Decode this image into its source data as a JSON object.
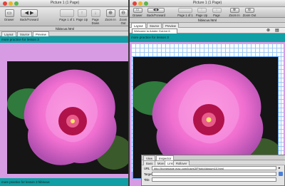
{
  "left_window": {
    "title": "Picture 1 (1 Page)",
    "toolbar": {
      "drawer": "Drawer",
      "back_forward": "Back/Forward",
      "page_of": "Page 1 of 1",
      "page_up": "Page Up",
      "page_down": "Page Down",
      "zoom_in": "Zoom In",
      "zoom_out": "Zoom Out"
    },
    "doc_title": "hibiscus.html",
    "tabs": [
      "Layout",
      "Source",
      "Preview"
    ],
    "heading": "more practice for lesson 3",
    "footer_text": "more practice for lesson 3 hibiscus"
  },
  "right_window": {
    "title": "Picture 1 (1 Page)",
    "toolbar": {
      "drawer": "Drawer",
      "back_forward": "Back/Forward",
      "page_of": "Page 1 of 1",
      "page_up": "Page Up",
      "page_down": "Page Down",
      "zoom_in": "Zoom In",
      "zoom_out": "Zoom Out"
    },
    "doc_title": "hibiscus.html",
    "tabs": [
      "Layout",
      "Source",
      "Preview"
    ],
    "address": "Welcome to Adobe GoLive 6",
    "heading": "more practice for lesson 3"
  },
  "inspector": {
    "panel_tabs": [
      "View",
      "Inspector"
    ],
    "sub_tabs": [
      "Basic",
      "More",
      "Link",
      "Rollover"
    ],
    "url_label": "URL",
    "url_value": "http://homepage.mac.com/juses3/Photo4dosum10.html",
    "target_label": "Target",
    "title_label": "Title"
  },
  "colors": {
    "page_bg": "#d79be4",
    "teal_bar": "#0f9fa4",
    "desktop": "#6f5fb0"
  }
}
